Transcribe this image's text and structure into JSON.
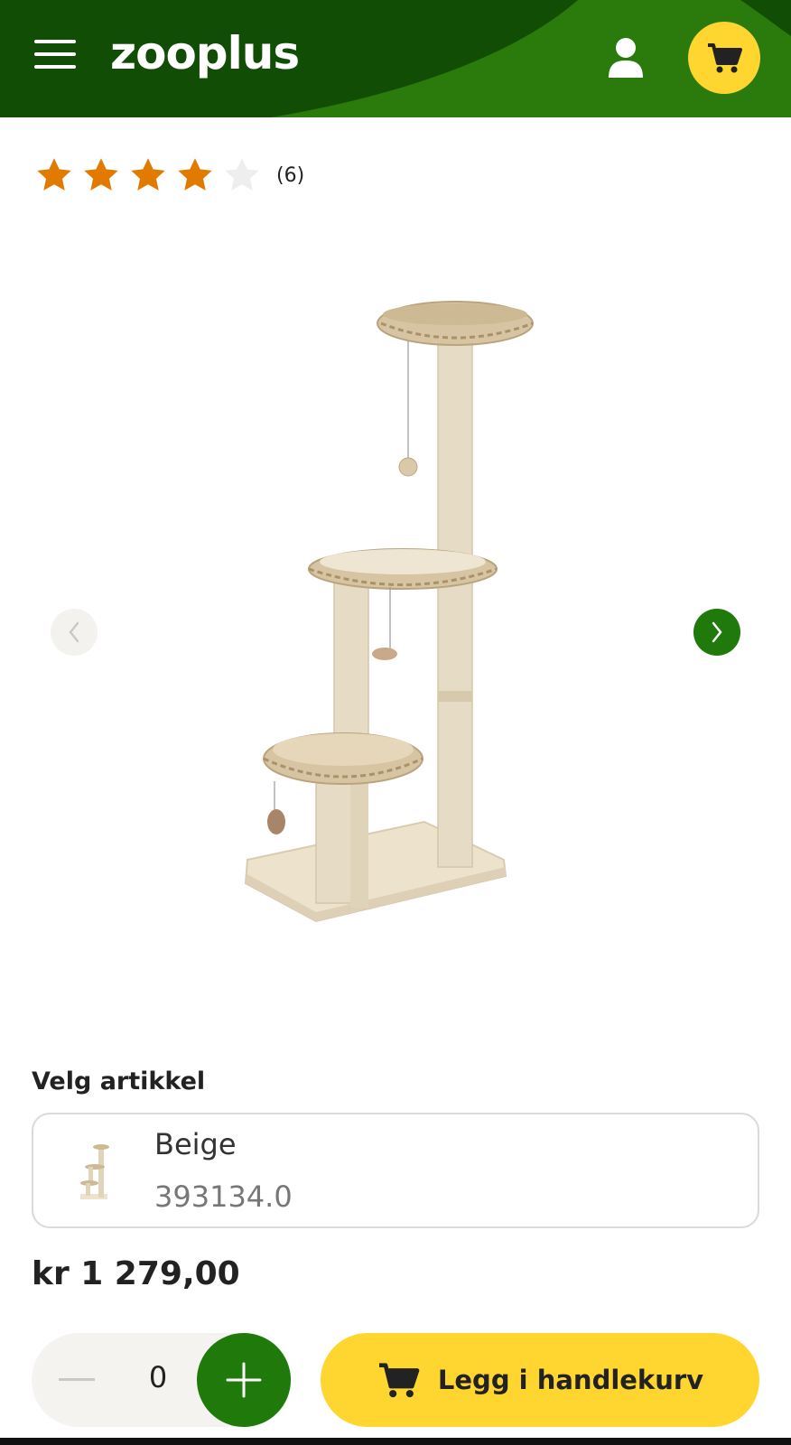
{
  "header": {
    "logo_text": "zooplus",
    "menu_icon": "hamburger-menu-icon",
    "user_icon": "user-icon",
    "cart_icon": "cart-icon",
    "colors": {
      "header_green": "#2a7a0c",
      "header_dark_green": "#124d05",
      "cart_yellow": "#ffd530"
    }
  },
  "rating": {
    "stars_filled": 4,
    "stars_total": 5,
    "review_count": "(6)",
    "colors": {
      "filled": "#e07b00",
      "empty": "#eeeeee"
    }
  },
  "gallery": {
    "prev_icon": "chevron-left-icon",
    "next_icon": "chevron-right-icon"
  },
  "variant": {
    "section_label": "Velg artikkel",
    "name": "Beige",
    "sku": "393134.0"
  },
  "price": "kr 1 279,00",
  "actions": {
    "quantity": "0",
    "minus_icon": "minus-icon",
    "plus_icon": "plus-icon",
    "add_to_cart_label": "Legg i handlekurv",
    "colors": {
      "plus_green": "#1f7a0b",
      "add_yellow": "#ffd530"
    }
  }
}
